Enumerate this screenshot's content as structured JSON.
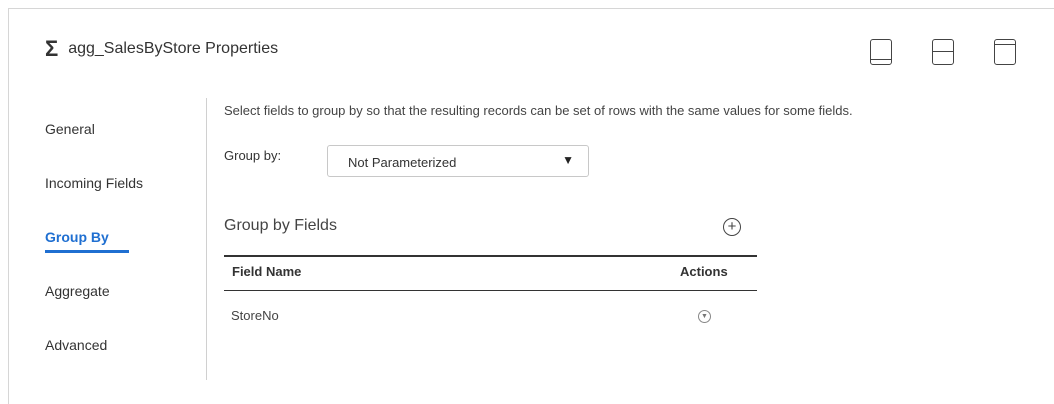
{
  "header": {
    "icon": "sigma-icon",
    "title": "agg_SalesByStore Properties",
    "view_buttons": [
      "panel-bottom-icon",
      "panel-split-icon",
      "panel-top-icon"
    ]
  },
  "tabs": [
    {
      "label": "General",
      "active": false
    },
    {
      "label": "Incoming Fields",
      "active": false
    },
    {
      "label": "Group By",
      "active": true
    },
    {
      "label": "Aggregate",
      "active": false
    },
    {
      "label": "Advanced",
      "active": false
    }
  ],
  "content": {
    "description": "Select fields to group by so that the resulting records can be set of rows with the same values for some fields.",
    "group_by_label": "Group by:",
    "group_by_value": "Not Parameterized",
    "section_title": "Group by Fields",
    "table": {
      "columns": [
        "Field Name",
        "Actions"
      ],
      "rows": [
        {
          "field_name": "StoreNo"
        }
      ]
    }
  },
  "colors": {
    "accent": "#1f6fd1",
    "text": "#333333",
    "border": "#d6d6d6"
  }
}
